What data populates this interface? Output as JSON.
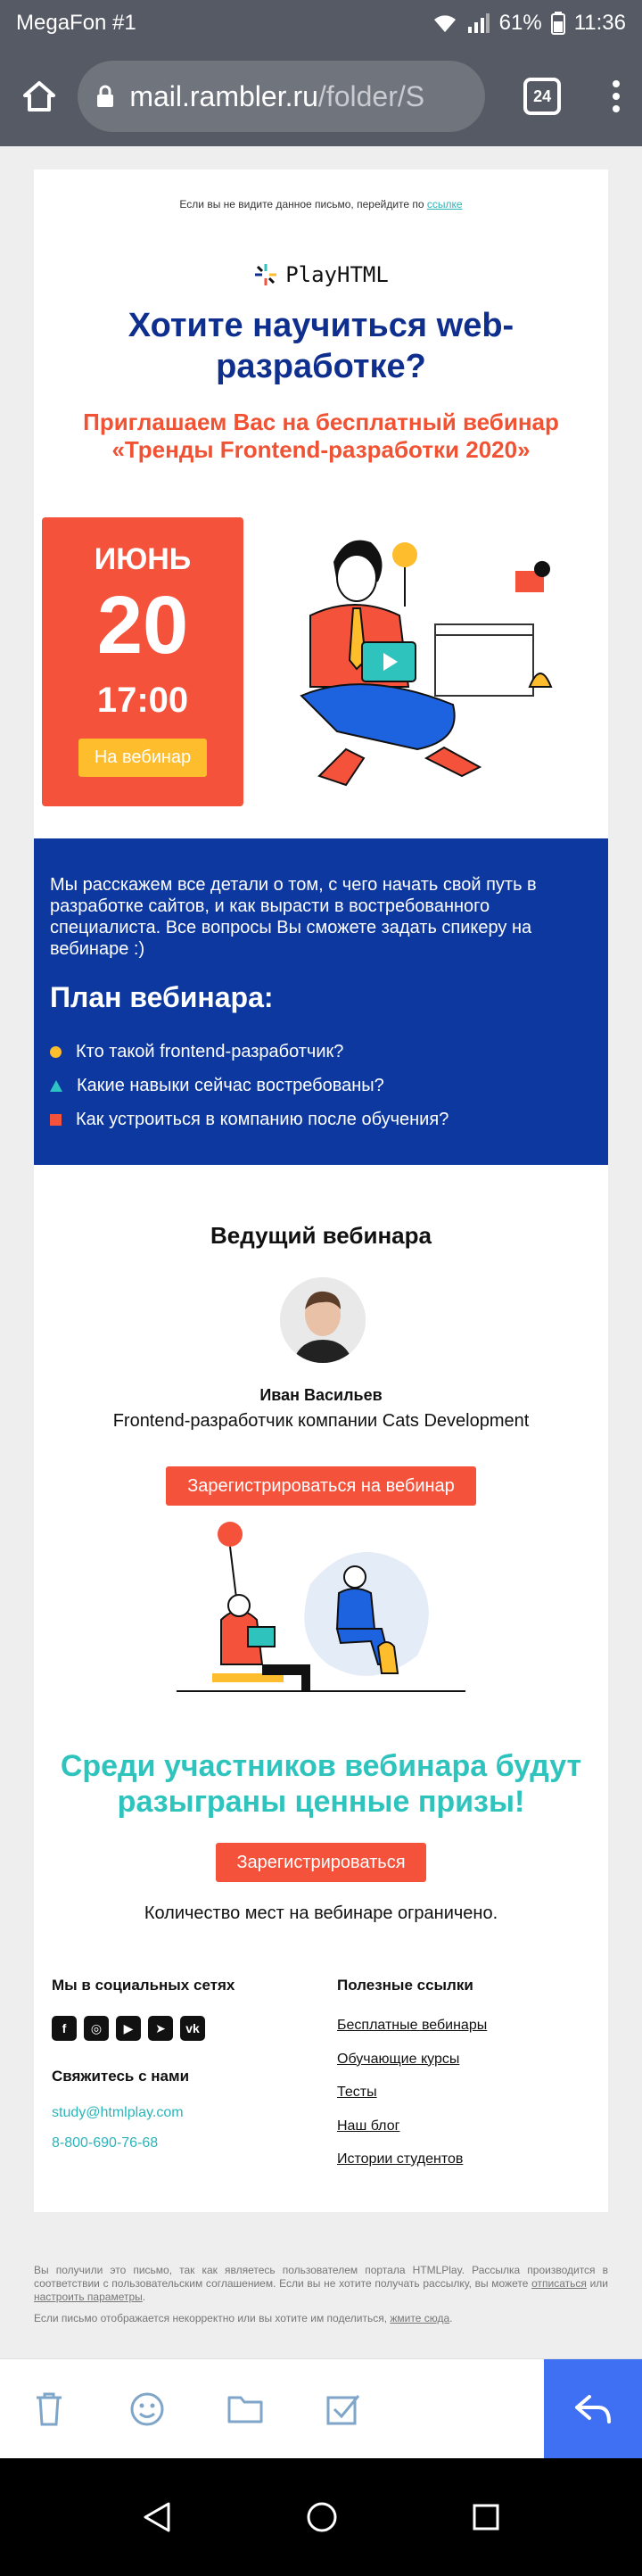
{
  "statusbar": {
    "carrier": "MegaFon #1",
    "battery": "61%",
    "time": "11:36"
  },
  "browser": {
    "url_host": "mail.rambler.ru",
    "url_path": "/folder/S",
    "tab_count": "24"
  },
  "email": {
    "top_note": "Если вы не видите данное письмо, перейдите по ",
    "top_note_link": "ссылке",
    "logo_text": "PlayHTML",
    "headline": "Хотите научиться web-разработке?",
    "subheadline": "Приглашаем Вас на бесплатный вебинар «Тренды Frontend-разработки 2020»",
    "date": {
      "month": "ИЮНЬ",
      "day": "20",
      "time": "17:00",
      "button": "На вебинар"
    },
    "info": {
      "text": "Мы расскажем все детали о том, с чего начать свой путь в разработке сайтов, и как вырасти в востребованного специалиста. Все вопросы Вы сможете задать спикеру на вебинаре :)",
      "plan_title": "План вебинара:",
      "plan_items": [
        "Кто такой frontend-разработчик?",
        "Какие навыки сейчас востребованы?",
        "Как устроиться в компанию после обучения?"
      ]
    },
    "speaker": {
      "title": "Ведущий вебинара",
      "name": "Иван Васильев",
      "role": "Frontend-разработчик компании Cats Development",
      "button": "Зарегистрироваться на вебинар"
    },
    "prize": {
      "text": "Среди участников вебинара будут разыграны ценные призы!",
      "button": "Зарегистрироваться",
      "limited": "Количество мест на вебинаре ограничено."
    },
    "footer": {
      "social_title": "Мы в социальных сетях",
      "contact_title": "Свяжитесь с нами",
      "email": "study@htmlplay.com",
      "phone": "8-800-690-76-68",
      "links_title": "Полезные ссылки",
      "links": [
        "Бесплатные вебинары",
        "Обучающие курсы",
        "Тесты",
        "Наш блог",
        "Истории студентов"
      ]
    }
  },
  "legal": {
    "text_pre": "Вы получили это письмо, так как являетесь пользователем портала HTMLPlay. Рассылка производится в соответствии с пользовательским соглашением. Если вы не хотите получать рассылку, вы можете ",
    "unsubscribe": "отписаться",
    "text_mid": " или ",
    "settings": "настроить параметры",
    "text_end": ".",
    "share_pre": "Если письмо отображается некорректно или вы хотите им поделиться, ",
    "share_link": "жмите сюда",
    "share_end": "."
  },
  "colors": {
    "navy": "#0f2f8f",
    "coral": "#f4523b",
    "teal": "#2ec4bd",
    "yellow": "#fdbd2c",
    "blue_block": "#0c38a0",
    "reply": "#3f6ff3"
  }
}
